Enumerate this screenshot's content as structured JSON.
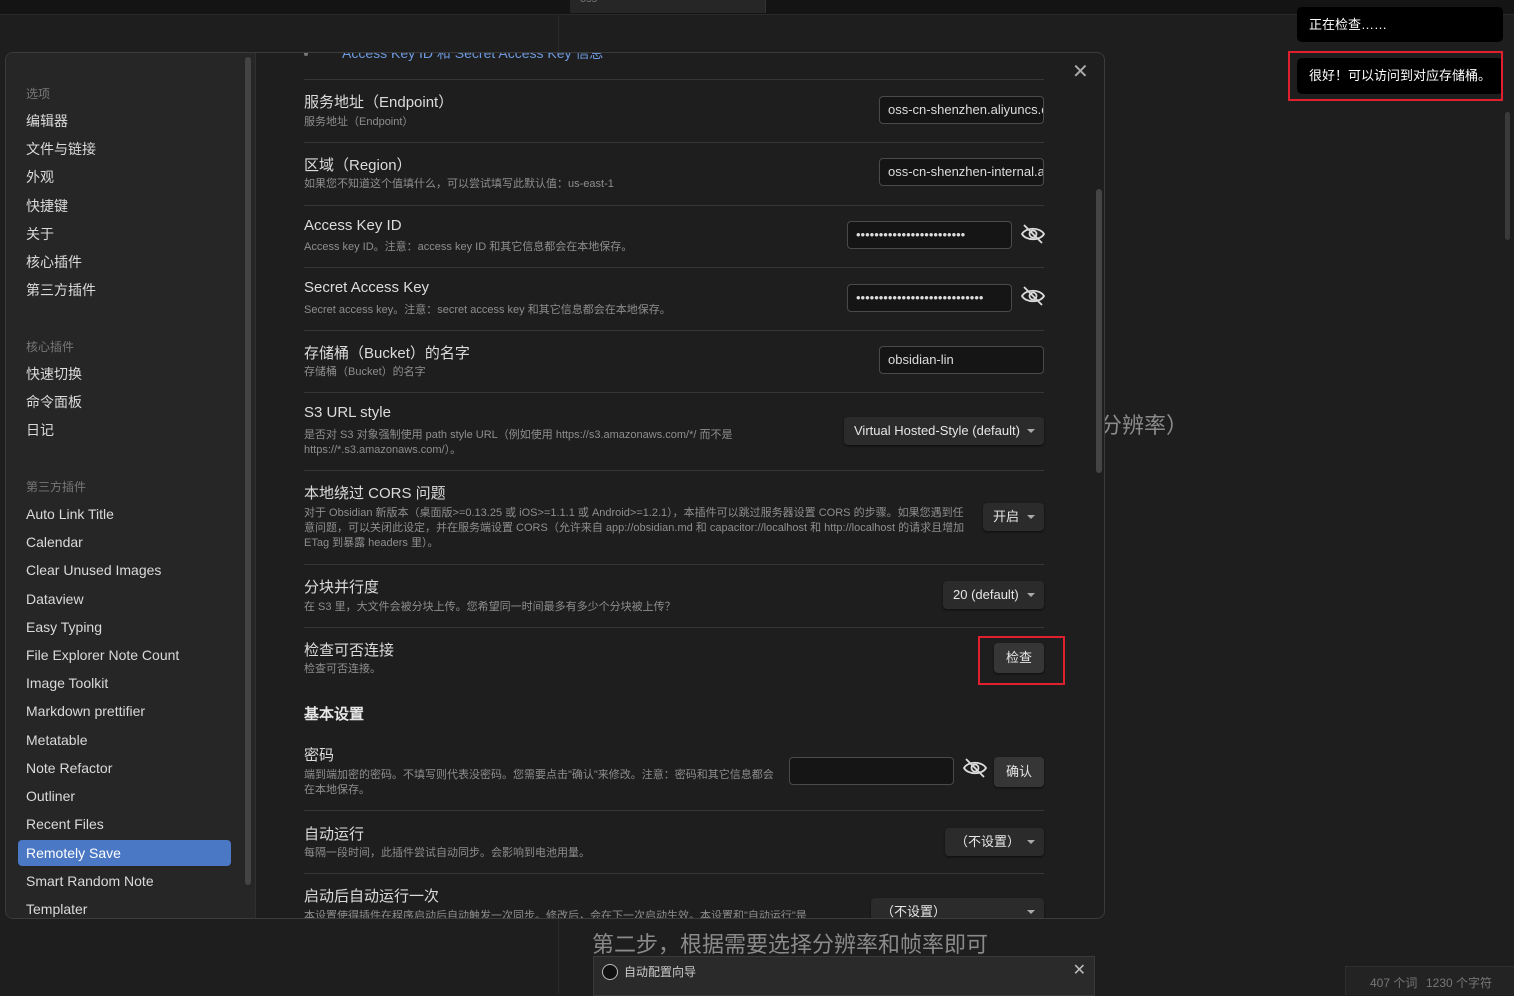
{
  "background": {
    "tab_label": "oss",
    "heading_fragment": "分辨率）",
    "step_text": "第二步，根据需要选择分辨率和帧率即可",
    "wizard_title": "自动配置向导",
    "status": {
      "words": "407 个词",
      "chars": "1230 个字符"
    }
  },
  "notices": [
    "正在检查……",
    "很好！可以访问到对应存储桶。"
  ],
  "sidebar": {
    "options_heading": "选项",
    "options": [
      "编辑器",
      "文件与链接",
      "外观",
      "快捷键",
      "关于",
      "核心插件",
      "第三方插件"
    ],
    "core_heading": "核心插件",
    "core": [
      "快速切换",
      "命令面板",
      "日记"
    ],
    "community_heading": "第三方插件",
    "community": [
      "Auto Link Title",
      "Calendar",
      "Clear Unused Images",
      "Dataview",
      "Easy Typing",
      "File Explorer Note Count",
      "Image Toolkit",
      "Markdown prettifier",
      "Metatable",
      "Note Refactor",
      "Outliner",
      "Recent Files",
      "Remotely Save",
      "Smart Random Note",
      "Templater"
    ],
    "active_item": "Remotely Save"
  },
  "content": {
    "top_link": "Access Key ID 和 Secret Access Key 信息",
    "endpoint": {
      "name": "服务地址（Endpoint）",
      "desc": "服务地址（Endpoint）",
      "value": "oss-cn-shenzhen.aliyuncs.com"
    },
    "region": {
      "name": "区域（Region）",
      "desc": "如果您不知道这个值填什么，可以尝试填写此默认值：us-east-1",
      "value": "oss-cn-shenzhen-internal.aliyuncs.com"
    },
    "access_key": {
      "name": "Access Key ID",
      "desc": "Access key ID。注意：access key ID 和其它信息都会在本地保存。",
      "value": "••••••••••••••••••••••••"
    },
    "secret_key": {
      "name": "Secret Access Key",
      "desc": "Secret access key。注意：secret access key 和其它信息都会在本地保存。",
      "value": "••••••••••••••••••••••••••••"
    },
    "bucket": {
      "name": "存储桶（Bucket）的名字",
      "desc": "存储桶（Bucket）的名字",
      "value": "obsidian-lin"
    },
    "s3_url_style": {
      "name": "S3 URL style",
      "desc": "是否对 S3 对象强制使用 path style URL（例如使用 https://s3.amazonaws.com/*/ 而不是 https://*.s3.amazonaws.com/）。",
      "value": "Virtual Hosted-Style (default)"
    },
    "cors": {
      "name": "本地绕过 CORS 问题",
      "desc": "对于 Obsidian 新版本（桌面版>=0.13.25 或 iOS>=1.1.1 或 Android>=1.2.1），本插件可以跳过服务器设置 CORS 的步骤。如果您遇到任意问题，可以关闭此设定，并在服务端设置 CORS（允许来自 app://obsidian.md 和 capacitor://localhost 和 http://localhost 的请求且增加 ETag 到暴露 headers 里）。",
      "value": "开启"
    },
    "parallel": {
      "name": "分块并行度",
      "desc": "在 S3 里，大文件会被分块上传。您希望同一时间最多有多少个分块被上传？",
      "value": "20 (default)"
    },
    "check": {
      "name": "检查可否连接",
      "desc": "检查可否连接。",
      "button": "检查"
    },
    "basic_title": "基本设置",
    "password": {
      "name": "密码",
      "desc": "端到端加密的密码。不填写则代表没密码。您需要点击\"确认\"来修改。注意：密码和其它信息都会在本地保存。",
      "value": "",
      "confirm": "确认"
    },
    "auto_run": {
      "name": "自动运行",
      "desc": "每隔一段时间，此插件尝试自动同步。会影响到电池用量。",
      "value": "（不设置）"
    },
    "run_once": {
      "name": "启动后自动运行一次",
      "desc": "本设置使得插件在程序启动后自动触发一次同步。修改后，会在下一次启动生效。本设置和\"自动运行\"是",
      "value": "（不设置）"
    }
  }
}
